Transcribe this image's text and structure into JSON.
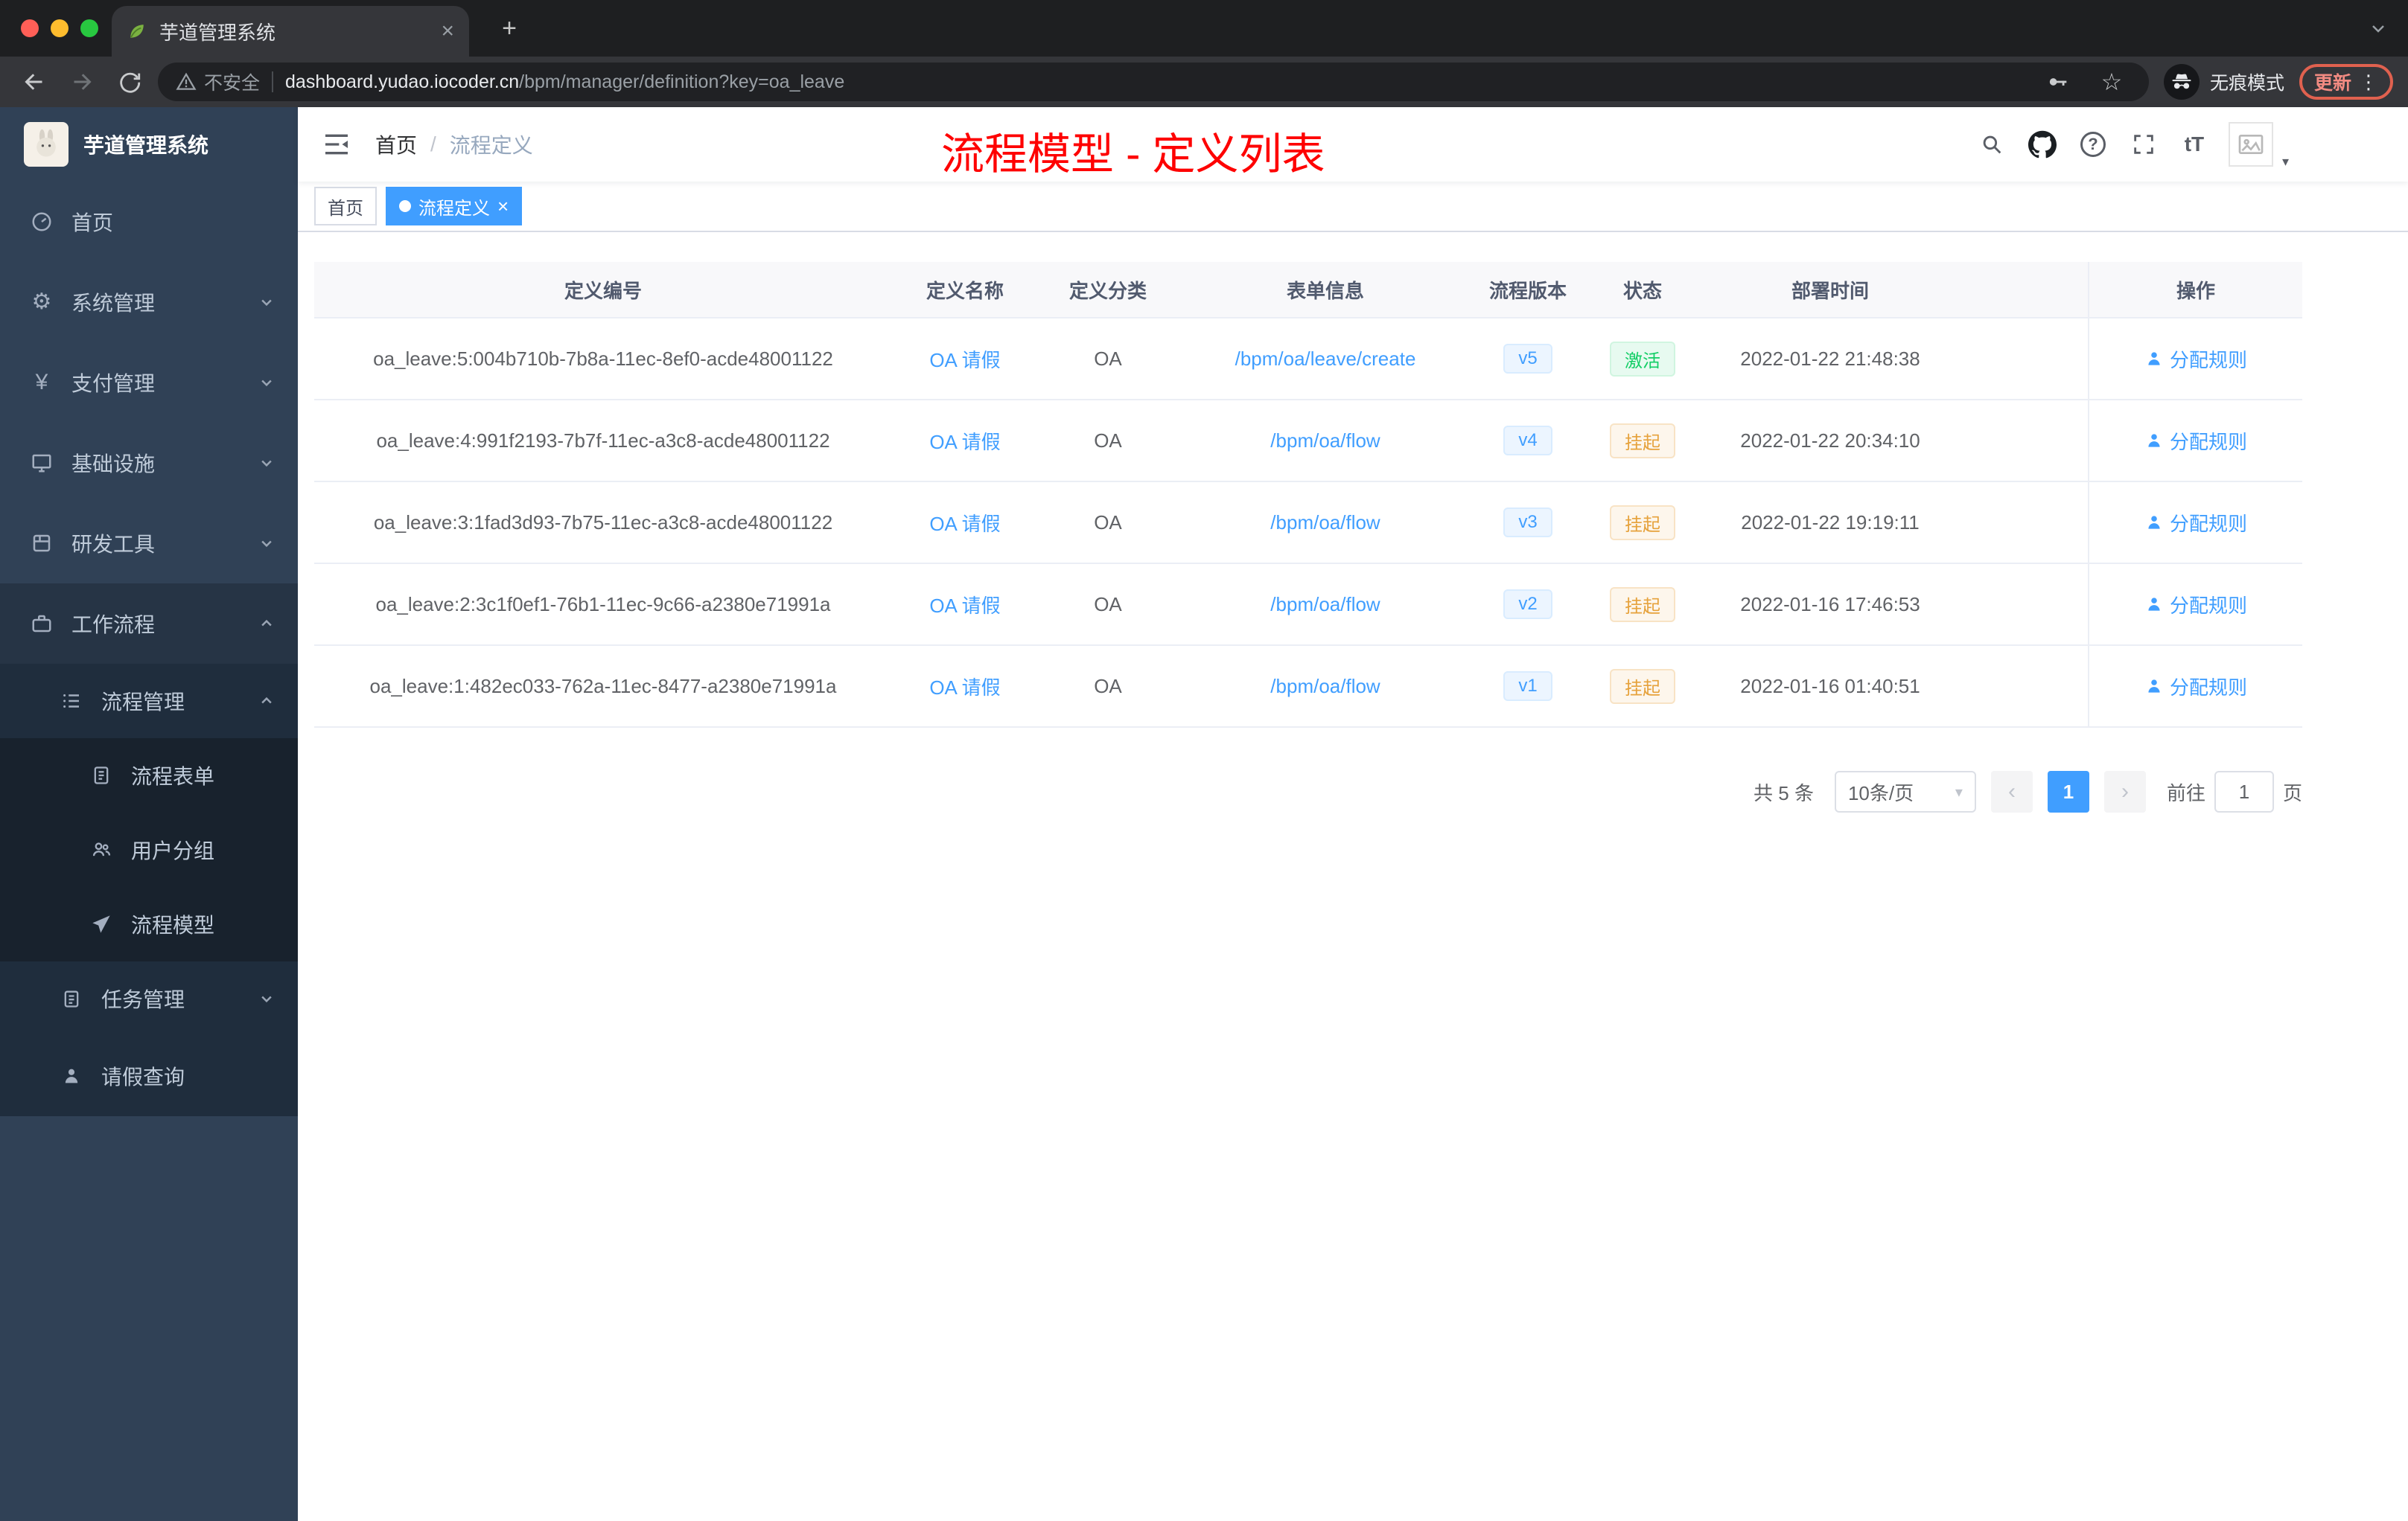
{
  "colors": {
    "accent": "#409eff",
    "annotation_red": "#fe0000",
    "sidebar_bg": "#304156",
    "status_active_green": "#13ce66",
    "status_suspend_orange": "#e6a23c"
  },
  "icons": {
    "plus": "+",
    "close": "×",
    "dots": "⋮",
    "star": "☆",
    "question": "?",
    "fontsize": "tT",
    "gear": "⚙",
    "yen": "¥",
    "caret_down": "▾",
    "chev_left": "‹",
    "chev_right": "›"
  },
  "browser": {
    "tab_title": "芋道管理系统",
    "security_label": "不安全",
    "url_domain": "dashboard.yudao.iocoder.cn",
    "url_path": "/bpm/manager/definition?key=oa_leave",
    "incognito_label": "无痕模式",
    "update_label": "更新"
  },
  "sidebar": {
    "logo_title": "芋道管理系统",
    "items": [
      {
        "label": "首页"
      },
      {
        "label": "系统管理"
      },
      {
        "label": "支付管理"
      },
      {
        "label": "基础设施"
      },
      {
        "label": "研发工具"
      },
      {
        "label": "工作流程"
      },
      {
        "label": "流程管理"
      },
      {
        "label": "流程表单"
      },
      {
        "label": "用户分组"
      },
      {
        "label": "流程模型"
      },
      {
        "label": "任务管理"
      },
      {
        "label": "请假查询"
      }
    ]
  },
  "header": {
    "breadcrumb_home": "首页",
    "breadcrumb_separator": "/",
    "breadcrumb_current": "流程定义",
    "annotation": "流程模型 - 定义列表"
  },
  "tags": {
    "home": "首页",
    "active": "流程定义"
  },
  "table": {
    "columns": [
      "定义编号",
      "定义名称",
      "定义分类",
      "表单信息",
      "流程版本",
      "状态",
      "部署时间",
      "操作"
    ],
    "rows": [
      {
        "id": "oa_leave:5:004b710b-7b8a-11ec-8ef0-acde48001122",
        "name": "OA 请假",
        "category": "OA",
        "form": "/bpm/oa/leave/create",
        "version": "v5",
        "status": "激活",
        "status_type": "success",
        "deployed": "2022-01-22 21:48:38",
        "action": "分配规则"
      },
      {
        "id": "oa_leave:4:991f2193-7b7f-11ec-a3c8-acde48001122",
        "name": "OA 请假",
        "category": "OA",
        "form": "/bpm/oa/flow",
        "version": "v4",
        "status": "挂起",
        "status_type": "warning",
        "deployed": "2022-01-22 20:34:10",
        "action": "分配规则"
      },
      {
        "id": "oa_leave:3:1fad3d93-7b75-11ec-a3c8-acde48001122",
        "name": "OA 请假",
        "category": "OA",
        "form": "/bpm/oa/flow",
        "version": "v3",
        "status": "挂起",
        "status_type": "warning",
        "deployed": "2022-01-22 19:19:11",
        "action": "分配规则"
      },
      {
        "id": "oa_leave:2:3c1f0ef1-76b1-11ec-9c66-a2380e71991a",
        "name": "OA 请假",
        "category": "OA",
        "form": "/bpm/oa/flow",
        "version": "v2",
        "status": "挂起",
        "status_type": "warning",
        "deployed": "2022-01-16 17:46:53",
        "action": "分配规则"
      },
      {
        "id": "oa_leave:1:482ec033-762a-11ec-8477-a2380e71991a",
        "name": "OA 请假",
        "category": "OA",
        "form": "/bpm/oa/flow",
        "version": "v1",
        "status": "挂起",
        "status_type": "warning",
        "deployed": "2022-01-16 01:40:51",
        "action": "分配规则"
      }
    ]
  },
  "pagination": {
    "total": "共 5 条",
    "page_size": "10条/页",
    "current": "1",
    "goto_prefix": "前往",
    "goto_value": "1",
    "goto_suffix": "页"
  }
}
